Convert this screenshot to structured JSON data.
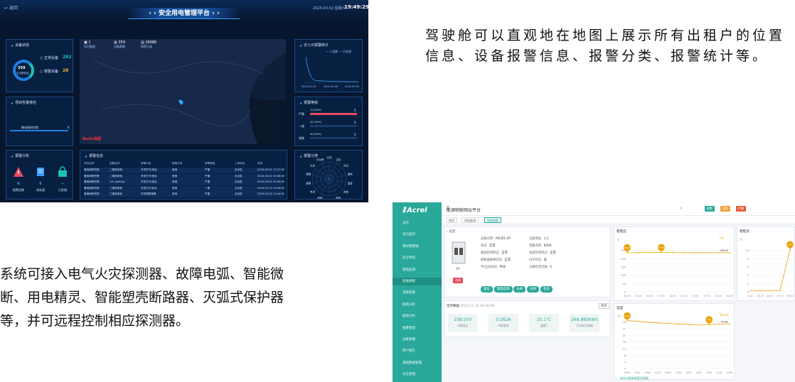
{
  "dashboard": {
    "back_label": "返回",
    "title": "安全用电管理平台",
    "date": "2024-03-02",
    "weekday": "星期六",
    "time": "19:49:29",
    "panels": {
      "device_status": "设备状态",
      "ranking": "项目告警排名",
      "alarm_analysis": "报警分析",
      "alarm_info": "报警信息",
      "seven_day": "近七日报警统计",
      "alarm_level": "报警等级",
      "alarm_category": "报警分类"
    },
    "device_total": "359",
    "device_total_label": "总设备数量",
    "devices": [
      {
        "label": "正常设备",
        "value": "282",
        "color": "#19c3b0"
      },
      {
        "label": "报警设备",
        "value": "28",
        "color": "#f2b233"
      }
    ],
    "map_stats": [
      {
        "value": "1",
        "label": "项目数量"
      },
      {
        "value": "359",
        "label": "设备数量"
      },
      {
        "value": "26686",
        "label": "报警记录"
      }
    ],
    "map_logo": "Baidu地图",
    "ranking_items": [
      {
        "name": "微电网研究院",
        "value": "6"
      }
    ],
    "alarm_stats": [
      {
        "value": "6",
        "label": "报警总数",
        "icon": "warning-icon"
      },
      {
        "value": "6",
        "label": "未处理",
        "icon": "document-icon"
      },
      {
        "value": "--",
        "label": "已处理",
        "icon": "lock-icon"
      }
    ],
    "table_headers": [
      "项目名称",
      "回路名称",
      "报警内容",
      "报警分类",
      "报警等级",
      "工单状态",
      "时间"
    ],
    "table_rows": [
      [
        "微电网研究院",
        "二楼机房柜",
        "开关打开/闭合",
        "其他",
        "严重",
        "无派发",
        "2024-03-01 11:17:00"
      ],
      [
        "微电网研究院",
        "二楼机房柜",
        "开关打开/闭合",
        "其他",
        "严重",
        "无派发",
        "2024-03-01 00:38:00"
      ],
      [
        "微电网研究院",
        "1#-Lighting",
        "开关打开/闭合",
        "其他",
        "严重",
        "无派发",
        "2024-03-01 09:40:00"
      ],
      [
        "微电网研究院",
        "三楼机房柜",
        "开关打开/闭合",
        "其他",
        "一般",
        "无派发",
        "2024-02-23 12:00:00"
      ],
      [
        "微电网研究院",
        "三楼机房柜",
        "开关故障报警",
        "其他",
        "严重",
        "无派发",
        "2024-02-23 11:44:00"
      ]
    ],
    "legend": [
      "人员数",
      "已处理"
    ],
    "seven_day_x": [
      "2024.02.25",
      "2024.02.28",
      "2024.03.02"
    ],
    "level_rows": [
      {
        "label": "严重",
        "value": "7(0.00%)",
        "count": "0",
        "color": "#e84a5f"
      },
      {
        "label": "一般",
        "value": "2(1.00%)",
        "count": "0",
        "color": "#3aa0ff"
      },
      {
        "label": "轻微",
        "value": "0(0.00%)",
        "count": "0",
        "color": "#3aa0ff"
      }
    ],
    "category_labels": [
      "过流",
      "过压",
      "欠压",
      "漏电",
      "温度",
      "其他",
      "断电",
      "谐波",
      "缺相",
      "电流",
      "故障",
      "超限",
      "光伏",
      "分合闸"
    ]
  },
  "text_right": "驾驶舱可以直观地在地图上展示所有出租户的位置信息、设备报警信息、报警分类、报警统计等。",
  "text_left": "系统可接入电气火灾探测器、故障电弧、智能微断、用电精灵、智能塑壳断路器、灭弧式保护器等，并可远程控制相应探测器。",
  "iot": {
    "logo": "Acrel",
    "title": "能源物联网云平台",
    "tabs": [
      "首页",
      "用电监测",
      "智能微断"
    ],
    "header_badges": [
      {
        "label": "报警",
        "color": "#2aa89a"
      },
      {
        "label": "消防",
        "color": "#f2a33a"
      },
      {
        "label": "严重",
        "color": "#e85d3a"
      }
    ],
    "sidebar": [
      {
        "label": "首页",
        "level": 0
      },
      {
        "label": "电力监控",
        "level": 0
      },
      {
        "label": "预付费管理",
        "level": 0
      },
      {
        "label": "安全用电",
        "level": 0
      },
      {
        "label": "漏电监测",
        "level": 1
      },
      {
        "label": "智能微断",
        "level": 1,
        "active": true
      },
      {
        "label": "电能质量",
        "level": 0
      },
      {
        "label": "能耗分析",
        "level": 0
      },
      {
        "label": "能耗分析",
        "level": 0
      },
      {
        "label": "报警管理",
        "level": 0
      },
      {
        "label": "运维管理",
        "level": 0
      },
      {
        "label": "用户报告",
        "level": 0
      },
      {
        "label": "基础数据管理",
        "level": 0
      },
      {
        "label": "日志管理",
        "level": 0
      }
    ],
    "back_label": "返回",
    "device_model": "2P",
    "device_badge": "合闸",
    "device_fields": [
      {
        "label": "设备名称:",
        "value": "ASCB1-2P"
      },
      {
        "label": "设备地址:",
        "value": "1,1"
      },
      {
        "label": "状态:",
        "value": "正常"
      },
      {
        "label": "回路名称:",
        "value": "E604"
      },
      {
        "label": "漏电检测状态:",
        "value": "正常"
      },
      {
        "label": "温度检测状态:",
        "value": "正常"
      },
      {
        "label": "断路器故障状态:",
        "value": "正常"
      },
      {
        "label": "拉手状态:",
        "value": "关"
      },
      {
        "label": "手/自动状态:",
        "value": "手动"
      },
      {
        "label": "过载检测次数:",
        "value": "0"
      }
    ],
    "control_buttons": [
      "复位",
      "漏电自检",
      "分闸",
      "合闸",
      "更多"
    ],
    "realtime_title": "实时数据",
    "realtime_date": "2022-11-15 19:40:00",
    "more_label": "更多",
    "realtime": [
      {
        "value": "238.50V",
        "label": "A相电压"
      },
      {
        "value": "0.262A",
        "label": "A相电流"
      },
      {
        "value": "25.1℃",
        "label": "温度1"
      },
      {
        "value": "268.860kWh",
        "label": "正向有功电能"
      }
    ],
    "charts": [
      {
        "title": "相电压",
        "unit": "V",
        "legend": "Ua",
        "x": [
          "00:00",
          "02:00",
          "03:00",
          "07:30",
          "10:00",
          "12:30",
          "15:00",
          "17:30",
          "20:00",
          "23:55"
        ],
        "ylim": [
          0,
          300
        ],
        "yticks": [
          0,
          50,
          100,
          150,
          200,
          250
        ],
        "values": [
          236.03,
          236.5,
          237.2,
          237.8,
          236.9,
          236.4,
          236.0,
          236.3,
          236.4,
          236.65
        ],
        "markers": [
          {
            "label": "236.03",
            "index": 0
          },
          {
            "label": "237.84",
            "index": 3
          }
        ],
        "end_label": "236.65"
      },
      {
        "title": "相电流",
        "unit": "A",
        "legend": "",
        "x": [
          "0:00",
          "03:25",
          "04:00",
          "07:15",
          "09:00"
        ],
        "ylim": [
          0,
          12
        ],
        "yticks": [
          0,
          2,
          4,
          6,
          8,
          10
        ],
        "values": [
          0.3,
          0.3,
          0.3,
          0.3,
          10.2
        ],
        "markers": [
          {
            "label": "10.22",
            "index": 4
          }
        ]
      },
      {
        "title": "温度",
        "unit": "℃",
        "legend": "Temp1",
        "x": [
          "0000",
          "0220",
          "0400",
          "0715",
          "0940",
          "1205",
          "1430",
          "1655",
          "1920",
          "2145",
          "2355"
        ],
        "ylim": [
          0,
          30
        ],
        "yticks": [
          0,
          4,
          8,
          12,
          16,
          20,
          24,
          28
        ],
        "values": [
          28.8,
          28.6,
          28.0,
          27.5,
          27.2,
          26.9,
          26.6,
          26.4,
          26.5,
          26.8,
          26.89
        ],
        "markers": [
          {
            "label": "28.87",
            "index": 0
          },
          {
            "label": "26.1",
            "index": 8
          }
        ],
        "end_label": "26.89"
      }
    ],
    "bottom_note": "单击右侧查看更多数据"
  }
}
